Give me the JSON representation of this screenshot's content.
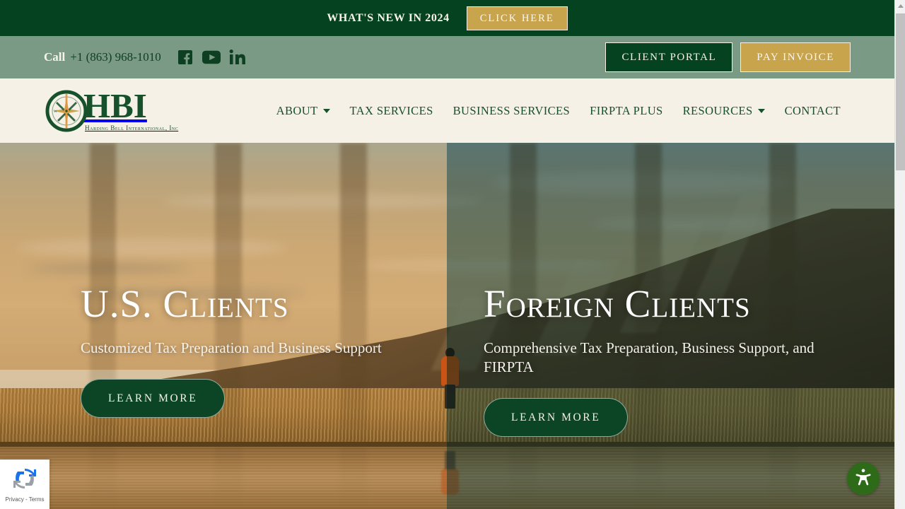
{
  "colors": {
    "dark_green": "#05421f",
    "sage_green": "#7a9a85",
    "cream": "#f5f1e6",
    "gold": "#c8a44d",
    "logo_green": "#16512c"
  },
  "announcement": {
    "text": "WHAT'S NEW IN 2024",
    "button_label": "CLICK HERE"
  },
  "utility_bar": {
    "call_label": "Call",
    "phone": "+1 (863) 968-1010",
    "socials": [
      {
        "name": "facebook-icon",
        "label": "Facebook"
      },
      {
        "name": "youtube-icon",
        "label": "YouTube"
      },
      {
        "name": "linkedin-icon",
        "label": "LinkedIn"
      }
    ],
    "client_portal_label": "CLIENT PORTAL",
    "pay_invoice_label": "PAY INVOICE"
  },
  "logo": {
    "initials": "HBI",
    "company": "Harding Bell International, Inc",
    "mark": "compass-rose-icon"
  },
  "nav": {
    "items": [
      {
        "label": "ABOUT",
        "has_dropdown": true
      },
      {
        "label": "TAX SERVICES",
        "has_dropdown": false
      },
      {
        "label": "BUSINESS SERVICES",
        "has_dropdown": false
      },
      {
        "label": "FIRPTA PLUS",
        "has_dropdown": false
      },
      {
        "label": "RESOURCES",
        "has_dropdown": true
      },
      {
        "label": "CONTACT",
        "has_dropdown": false
      }
    ]
  },
  "hero": {
    "panels": [
      {
        "title": "U.S. Clients",
        "subtitle": "Customized Tax Preparation and Business Support",
        "cta_label": "LEARN MORE"
      },
      {
        "title": "Foreign Clients",
        "subtitle": "Comprehensive Tax Preparation, Business Support, and FIRPTA",
        "cta_label": "LEARN MORE"
      }
    ]
  },
  "recaptcha": {
    "text": "Privacy - Terms",
    "icon": "recaptcha-icon"
  },
  "accessibility": {
    "icon": "accessibility-person-icon"
  },
  "nav_labels": {
    "0": "ABOUT",
    "1": "TAX SERVICES",
    "2": "BUSINESS SERVICES",
    "3": "FIRPTA PLUS",
    "4": "RESOURCES",
    "5": "CONTACT"
  }
}
